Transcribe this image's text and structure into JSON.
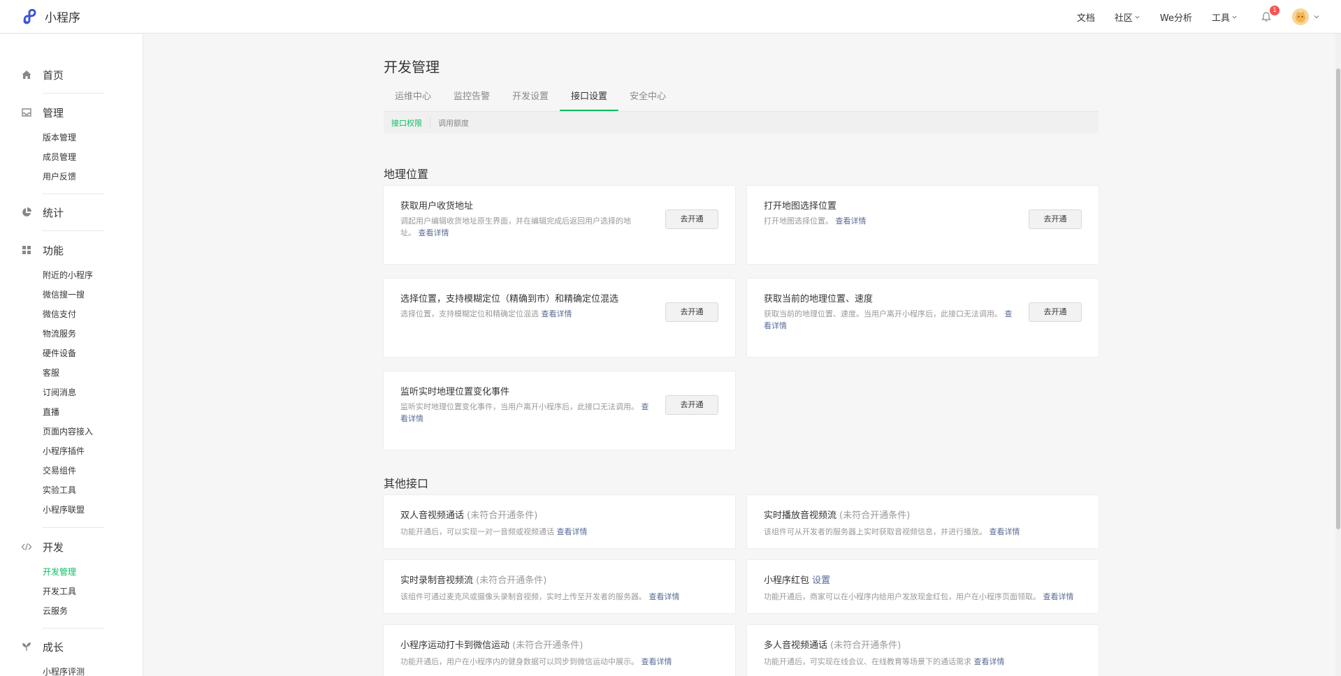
{
  "header": {
    "brand": "小程序",
    "nav": [
      {
        "label": "文档"
      },
      {
        "label": "社区"
      },
      {
        "label": "We分析"
      },
      {
        "label": "工具"
      }
    ],
    "notification_count": "1"
  },
  "sidebar": {
    "home": "首页",
    "manage": {
      "label": "管理",
      "items": [
        "版本管理",
        "成员管理",
        "用户反馈"
      ]
    },
    "stats": "统计",
    "features": {
      "label": "功能",
      "items": [
        "附近的小程序",
        "微信搜一搜",
        "微信支付",
        "物流服务",
        "硬件设备",
        "客服",
        "订阅消息",
        "直播",
        "页面内容接入",
        "小程序插件",
        "交易组件",
        "实验工具",
        "小程序联盟"
      ]
    },
    "dev": {
      "label": "开发",
      "items": [
        "开发管理",
        "开发工具",
        "云服务"
      ],
      "active": "开发管理"
    },
    "growth": {
      "label": "成长",
      "items": [
        "小程序评测"
      ]
    }
  },
  "main": {
    "title": "开发管理",
    "tabs": [
      "运维中心",
      "监控告警",
      "开发设置",
      "接口设置",
      "安全中心"
    ],
    "active_tab": "接口设置",
    "subtabs": [
      "接口权限",
      "调用额度"
    ],
    "active_subtab": "接口权限",
    "geo": {
      "title": "地理位置",
      "cards": [
        {
          "title": "获取用户收货地址",
          "desc_line1": "调起用户编辑收货地址原生界面，并在编辑完成后返回用户选择的地",
          "desc_line2": "址。",
          "link": "查看详情",
          "button": "去开通"
        },
        {
          "title": "打开地图选择位置",
          "desc_line1": "打开地图选择位置。",
          "link": "查看详情",
          "button": "去开通"
        },
        {
          "title": "选择位置，支持模糊定位（精确到市）和精确定位混选",
          "desc_line1": "选择位置，支持模糊定位和精确定位混选",
          "link": "查看详情",
          "button": "去开通"
        },
        {
          "title": "获取当前的地理位置、速度",
          "desc_line1": "获取当前的地理位置、速度。当用户离开小程序后，此接口无法调用。",
          "link": "查看详情",
          "button": "去开通"
        },
        {
          "title": "监听实时地理位置变化事件",
          "desc_line1": "监听实时地理位置变化事件，当用户离开小程序后，此接口无法调用。",
          "link": "查看详情",
          "button": "去开通"
        }
      ]
    },
    "other": {
      "title": "其他接口",
      "cards": [
        {
          "title": "双人音视频通话",
          "note": "(未符合开通条件)",
          "desc": "功能开通后，可以实现一对一音频或视频通话",
          "link": "查看详情"
        },
        {
          "title": "实时播放音视频流",
          "note": "(未符合开通条件)",
          "desc": "该组件可从开发者的服务器上实时获取音视频信息，并进行播放。",
          "link": "查看详情"
        },
        {
          "title": "实时录制音视频流",
          "note": "(未符合开通条件)",
          "desc": "该组件可通过麦克风或摄像头录制音视频，实时上传至开发者的服务器。",
          "link": "查看详情"
        },
        {
          "title": "小程序红包",
          "title_link": "设置",
          "desc": "功能开通后，商家可以在小程序内给用户发放现金红包，用户在小程序页面领取。",
          "link": "查看详情"
        },
        {
          "title": "小程序运动打卡到微信运动",
          "note": "(未符合开通条件)",
          "desc": "功能开通后，用户在小程序内的健身数据可以同步到微信运动中展示。",
          "link": "查看详情"
        },
        {
          "title": "多人音视频通话",
          "note": "(未符合开通条件)",
          "desc": "功能开通后，可实现在线会议、在线教育等场景下的通话需求",
          "link": "查看详情"
        }
      ]
    }
  },
  "colors": {
    "accent": "#07c160",
    "link": "#576b95",
    "badge": "#fa5151"
  }
}
